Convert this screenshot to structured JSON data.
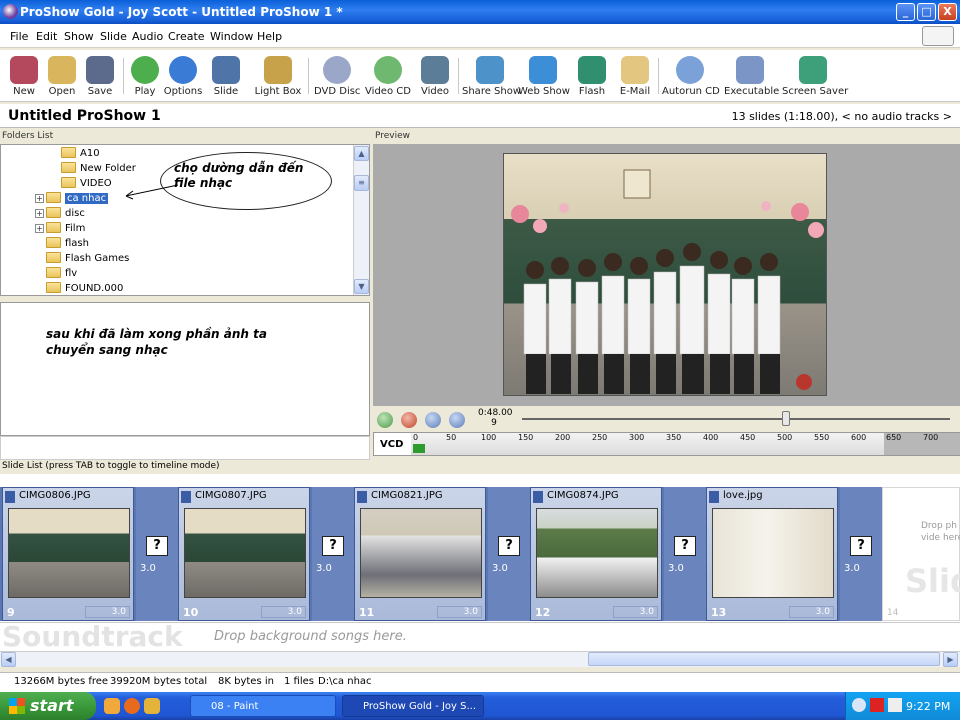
{
  "window": {
    "title": "ProShow Gold - Joy Scott - Untitled ProShow 1 *",
    "buttons": {
      "minimize": "_",
      "maximize": "□",
      "close": "X"
    }
  },
  "menu": [
    "File",
    "Edit",
    "Show",
    "Slide",
    "Audio",
    "Create",
    "Window",
    "Help"
  ],
  "toolbar": [
    {
      "label": "New",
      "icon": "new-show-icon",
      "color": "#b4485c"
    },
    {
      "label": "Open",
      "icon": "open-folder-icon",
      "color": "#d9b65e"
    },
    {
      "label": "Save",
      "icon": "save-disk-icon",
      "color": "#5c6b8c"
    },
    {
      "label": "Play",
      "icon": "play-icon",
      "color": "#4cae4c"
    },
    {
      "label": "Options",
      "icon": "options-globe-icon",
      "color": "#3a7bd5"
    },
    {
      "label": "Slide",
      "icon": "slide-filmstrip-icon",
      "color": "#4f74a8"
    },
    {
      "label": "Light Box",
      "icon": "light-box-icon",
      "color": "#c8a24a"
    },
    {
      "label": "DVD Disc",
      "icon": "dvd-disc-icon",
      "color": "#9aa7c9"
    },
    {
      "label": "Video CD",
      "icon": "video-cd-icon",
      "color": "#6fb86f"
    },
    {
      "label": "Video",
      "icon": "video-clapper-icon",
      "color": "#5b7d97"
    },
    {
      "label": "Share Show",
      "icon": "share-show-icon",
      "color": "#4d93c9"
    },
    {
      "label": "Web Show",
      "icon": "web-show-icon",
      "color": "#3c8ed6"
    },
    {
      "label": "Flash",
      "icon": "flash-icon",
      "color": "#2f8f6f"
    },
    {
      "label": "E-Mail",
      "icon": "email-envelope-icon",
      "color": "#e3c680"
    },
    {
      "label": "Autorun CD",
      "icon": "autorun-cd-icon",
      "color": "#7aa1d8"
    },
    {
      "label": "Executable",
      "icon": "executable-icon",
      "color": "#7c95c7"
    },
    {
      "label": "Screen Saver",
      "icon": "screen-saver-icon",
      "color": "#3ea07a"
    }
  ],
  "show": {
    "title": "Untitled ProShow 1",
    "info": "13 slides (1:18.00), < no audio tracks >"
  },
  "panels": {
    "folders_header": "Folders List",
    "preview_header": "Preview",
    "slide_list_header": "Slide List (press TAB to toggle to timeline mode)"
  },
  "folders": [
    "A10",
    "New Folder",
    "VIDEO",
    "ca nhac",
    "disc",
    "Film",
    "flash",
    "Flash Games",
    "flv",
    "FOUND.000"
  ],
  "annotations": {
    "bubble": "chọ dường dẫn đến file nhạc",
    "note": "sau khi đã làm xong phần ảnh ta chuyển sang nhạc"
  },
  "preview": {
    "timecode": "0:48.00",
    "slide_num": "9",
    "disc_label": "VCD",
    "ruler_ticks": [
      "0",
      "50",
      "100",
      "150",
      "200",
      "250",
      "300",
      "350",
      "400",
      "450",
      "500",
      "550",
      "600",
      "650",
      "700"
    ]
  },
  "slides": [
    {
      "name": "CIMG0806.JPG",
      "num": "9",
      "dur": "3.0",
      "trans": "3.0"
    },
    {
      "name": "CIMG0807.JPG",
      "num": "10",
      "dur": "3.0",
      "trans": "3.0"
    },
    {
      "name": "CIMG0821.JPG",
      "num": "11",
      "dur": "3.0",
      "trans": "3.0"
    },
    {
      "name": "CIMG0874.JPG",
      "num": "12",
      "dur": "3.0",
      "trans": "3.0"
    },
    {
      "name": "love.jpg",
      "num": "13",
      "dur": "3.0",
      "trans": "3.0"
    }
  ],
  "drop_slide": {
    "text": "Drop ph or vide here",
    "big": "Slid",
    "num": "14"
  },
  "soundtrack": {
    "label": "Soundtrack",
    "drop": "Drop background songs here."
  },
  "status": {
    "free": "13266M bytes free",
    "total": "39920M bytes total",
    "bytes_in": "8K bytes in",
    "files": "1 files",
    "path": "D:\\ca nhac"
  },
  "taskbar": {
    "start": "start",
    "tasks": [
      "08 - Paint",
      "ProShow Gold - Joy S..."
    ],
    "clock": "9:22 PM"
  }
}
